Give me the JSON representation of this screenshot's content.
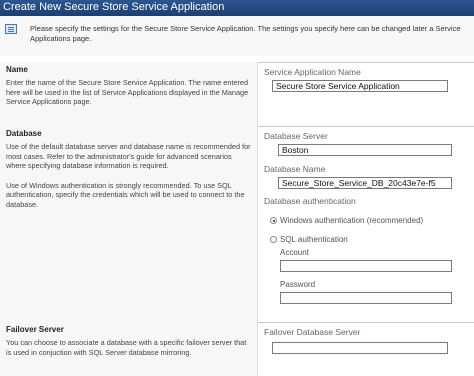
{
  "window": {
    "title": "Create New Secure Store Service Application"
  },
  "info": {
    "text": "Please specify the settings for the Secure Store Service Application. The settings you specify here can be changed later a Service Applications page."
  },
  "name_section": {
    "title": "Name",
    "description": "Enter the name of the Secure Store Service Application. The name entered here will be used in the list of Service Applications displayed in the Manage Service Applications page.",
    "field_label": "Service Application Name",
    "field_value": "Secure Store Service Application"
  },
  "database_section": {
    "title": "Database",
    "description_1": "Use of the default database server and database name is recommended for most cases. Refer to the administrator's guide for advanced scenarios where specifying database information is required.",
    "description_2": "Use of Windows authentication is strongly recommended. To use SQL authentication, specify the credentials which will be used to connect to the database.",
    "server_label": "Database Server",
    "server_value": "Boston",
    "name_label": "Database Name",
    "name_value": "Secure_Store_Service_DB_20c43e7e-f5",
    "auth_label": "Database authentication",
    "windows_auth": "Windows authentication (recommended)",
    "sql_auth": "SQL authentication",
    "account_label": "Account",
    "account_value": "",
    "password_label": "Password",
    "password_value": ""
  },
  "failover_section": {
    "title": "Failover Server",
    "description": "You can choose to associate a database with a specific failover server that is used in conjuction with SQL Server database mirroring.",
    "field_label": "Failover Database Server",
    "field_value": ""
  }
}
